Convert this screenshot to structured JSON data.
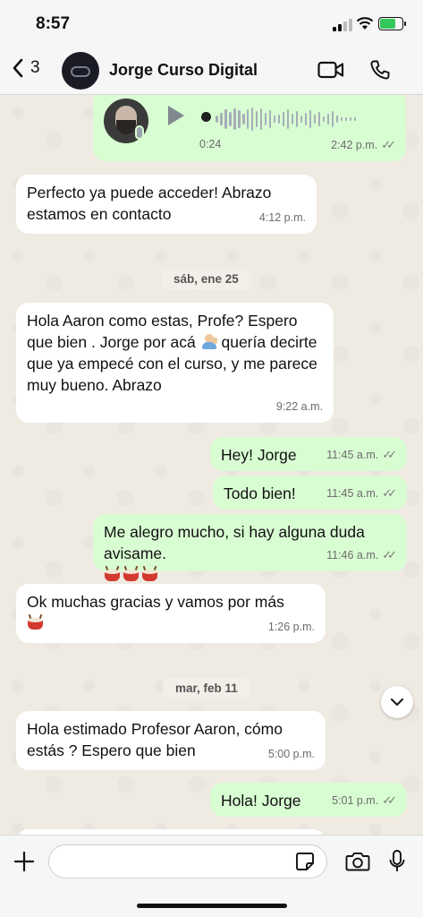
{
  "status_bar": {
    "time": "8:57"
  },
  "header": {
    "back_count": "3",
    "contact_name": "Jorge Curso Digital"
  },
  "voice_note": {
    "duration": "0:24",
    "time": "2:42 p.m."
  },
  "messages": [
    {
      "direction": "in",
      "text": "Perfecto ya puede acceder! Abrazo estamos en contacto",
      "time": "4:12 p.m."
    },
    {
      "direction": "in",
      "text_before_emoji": "Hola Aaron como estas, Profe? Espero que bien . Jorge por acá",
      "text_after_emoji": " quería decirte que ya empecé con el curso, y me parece muy bueno. Abrazo",
      "emoji": "person-raising-hand",
      "time": "9:22 a.m."
    },
    {
      "direction": "out",
      "text": "Hey! Jorge",
      "time": "11:45 a.m."
    },
    {
      "direction": "out",
      "text": "Todo bien!",
      "time": "11:45 a.m."
    },
    {
      "direction": "out",
      "text": "Me alegro mucho, si hay alguna duda avisame.",
      "emoji": "drum x3",
      "time": "11:46 a.m."
    },
    {
      "direction": "in",
      "text": "Ok muchas gracias y vamos por más",
      "emoji": "drum",
      "time": "1:26 p.m."
    },
    {
      "direction": "in",
      "text": "Hola estimado Profesor Aaron, cómo estás ? Espero que bien",
      "time": "5:00 p.m."
    },
    {
      "direction": "out",
      "text": "Hola! Jorge",
      "time": "5:01 p.m."
    }
  ],
  "date_separators": [
    "sáb, ene 25",
    "mar, feb 11"
  ],
  "composer": {
    "value": ""
  },
  "colors": {
    "incoming": "#ffffff",
    "outgoing": "#d9fdd3",
    "background": "#efeae2"
  }
}
